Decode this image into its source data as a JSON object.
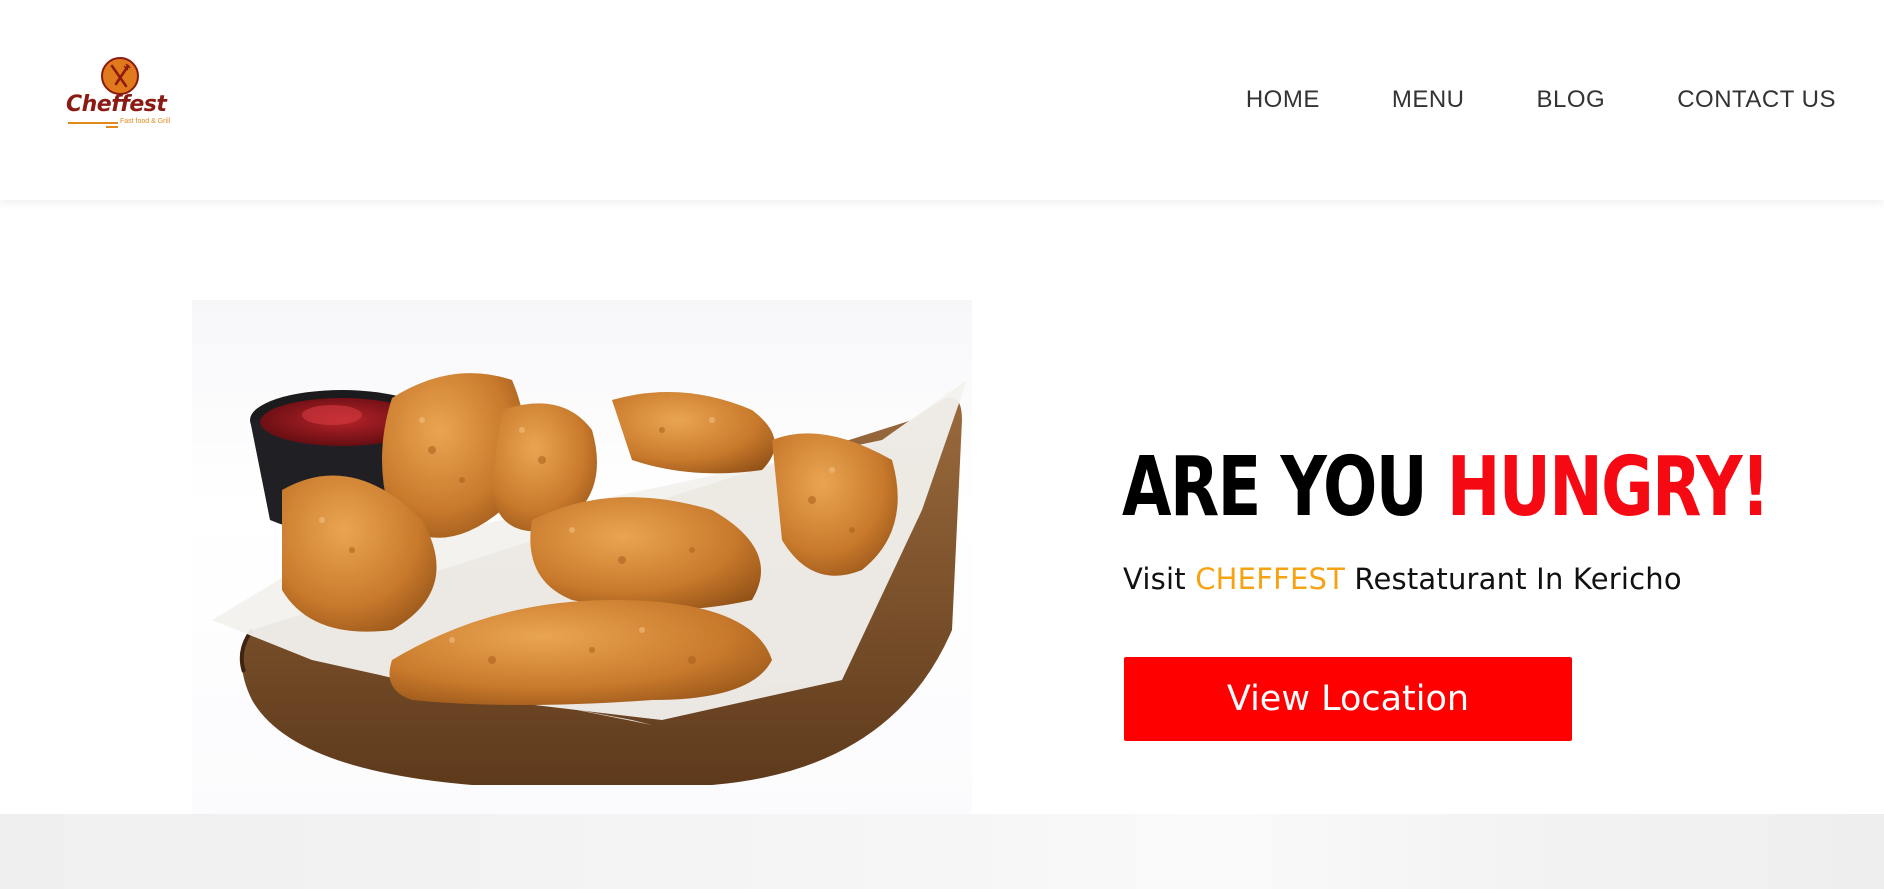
{
  "brand": {
    "name": "Cheffest",
    "tagline": "Fast food & Grill"
  },
  "nav": {
    "items": [
      {
        "label": "HOME"
      },
      {
        "label": "MENU"
      },
      {
        "label": "BLOG"
      },
      {
        "label": "CONTACT US"
      }
    ]
  },
  "hero": {
    "title_part1": "ARE YOU ",
    "title_part2": "HUNGRY!",
    "subtitle_prefix": "Visit ",
    "subtitle_brand": "CHEFFEST",
    "subtitle_suffix": " Restaturant In Kericho",
    "cta_label": "View Location"
  },
  "colors": {
    "accent_red": "#fe0000",
    "title_red": "#f50a14",
    "brand_orange": "#f5a312",
    "logo_brown": "#8b1a12"
  },
  "icons": {
    "logo_mark": "fork-knife-icon"
  }
}
